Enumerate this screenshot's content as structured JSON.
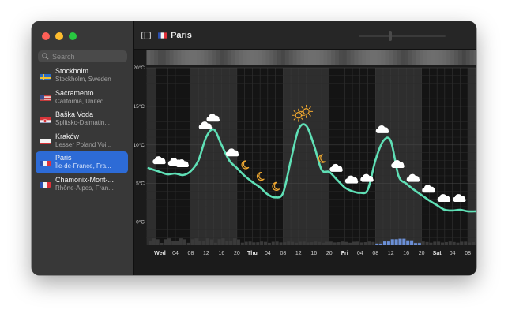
{
  "window": {
    "title": "Paris"
  },
  "search": {
    "placeholder": "Search"
  },
  "locations": [
    {
      "name": "Stockholm",
      "subtitle": "Stockholm, Sweden",
      "flag": "se",
      "selected": false
    },
    {
      "name": "Sacramento",
      "subtitle": "California, United...",
      "flag": "us",
      "selected": false
    },
    {
      "name": "Baška Voda",
      "subtitle": "Splitsko-Dalmatin...",
      "flag": "hr",
      "selected": false
    },
    {
      "name": "Kraków",
      "subtitle": "Lesser Poland Voi...",
      "flag": "pl",
      "selected": false
    },
    {
      "name": "Paris",
      "subtitle": "Île-de-France, Fra...",
      "flag": "fr",
      "selected": true
    },
    {
      "name": "Chamonix-Mont-...",
      "subtitle": "Rhône-Alpes, Fran...",
      "flag": "fr",
      "selected": false
    }
  ],
  "colors": {
    "accent": "#2d6bd6",
    "temp_line": "#5fe0b6",
    "precip": "#6b8fd6",
    "sun": "#f0a830",
    "moon": "#f0a830"
  },
  "chart_data": {
    "type": "line",
    "y_ticks": [
      "20°C",
      "15°C",
      "10°C",
      "5°C",
      "0°C"
    ],
    "ylim": [
      -3,
      20
    ],
    "x_tick_labels": [
      "Wed",
      "04",
      "08",
      "12",
      "16",
      "20",
      "Thu",
      "04",
      "08",
      "12",
      "16",
      "20",
      "Fri",
      "04",
      "08",
      "12",
      "16",
      "20",
      "Sat",
      "04",
      "08"
    ],
    "x_hours": [
      0,
      4,
      8,
      12,
      16,
      20,
      24,
      28,
      32,
      36,
      40,
      44,
      48,
      52,
      56,
      60,
      64,
      68,
      72,
      76,
      80
    ],
    "temperature": {
      "hours": [
        -3,
        0,
        2,
        4,
        6,
        8,
        10,
        12,
        14,
        16,
        18,
        20,
        22,
        24,
        26,
        28,
        30,
        32,
        34,
        36,
        38,
        40,
        42,
        44,
        46,
        48,
        50,
        52,
        54,
        56,
        58,
        60,
        62,
        64,
        66,
        68,
        70,
        72,
        74,
        76,
        78,
        80,
        82
      ],
      "values": [
        7,
        6.5,
        6.2,
        6.3,
        6.1,
        6.6,
        8.0,
        11.0,
        12.0,
        10.0,
        8.0,
        7.0,
        6.0,
        5.2,
        4.5,
        3.6,
        3.2,
        3.8,
        8.0,
        12.0,
        12.5,
        10.0,
        6.8,
        6.5,
        5.5,
        4.5,
        4.0,
        3.8,
        4.2,
        8.0,
        10.5,
        10.5,
        6.0,
        5.0,
        4.2,
        3.5,
        2.8,
        2.2,
        1.6,
        1.5,
        1.6,
        1.4,
        1.4
      ]
    },
    "precipitation": {
      "hours": [
        56,
        58,
        60,
        62,
        64,
        66
      ],
      "values": [
        0.15,
        0.35,
        0.55,
        0.6,
        0.45,
        0.2
      ]
    },
    "conditions": [
      {
        "hour": 0,
        "icon": "cloud"
      },
      {
        "hour": 4,
        "icon": "cloud"
      },
      {
        "hour": 6,
        "icon": "cloud"
      },
      {
        "hour": 12,
        "icon": "cloud"
      },
      {
        "hour": 14,
        "icon": "cloud"
      },
      {
        "hour": 19,
        "icon": "cloud"
      },
      {
        "hour": 22,
        "icon": "moon"
      },
      {
        "hour": 26,
        "icon": "moon"
      },
      {
        "hour": 30,
        "icon": "moon"
      },
      {
        "hour": 36,
        "icon": "sun"
      },
      {
        "hour": 38,
        "icon": "sun"
      },
      {
        "hour": 42,
        "icon": "moon"
      },
      {
        "hour": 46,
        "icon": "cloud"
      },
      {
        "hour": 50,
        "icon": "cloud"
      },
      {
        "hour": 54,
        "icon": "cloud"
      },
      {
        "hour": 58,
        "icon": "cloud"
      },
      {
        "hour": 62,
        "icon": "cloud"
      },
      {
        "hour": 66,
        "icon": "cloud"
      },
      {
        "hour": 70,
        "icon": "cloud"
      },
      {
        "hour": 74,
        "icon": "cloud"
      },
      {
        "hour": 78,
        "icon": "cloud"
      }
    ],
    "grid": true
  }
}
